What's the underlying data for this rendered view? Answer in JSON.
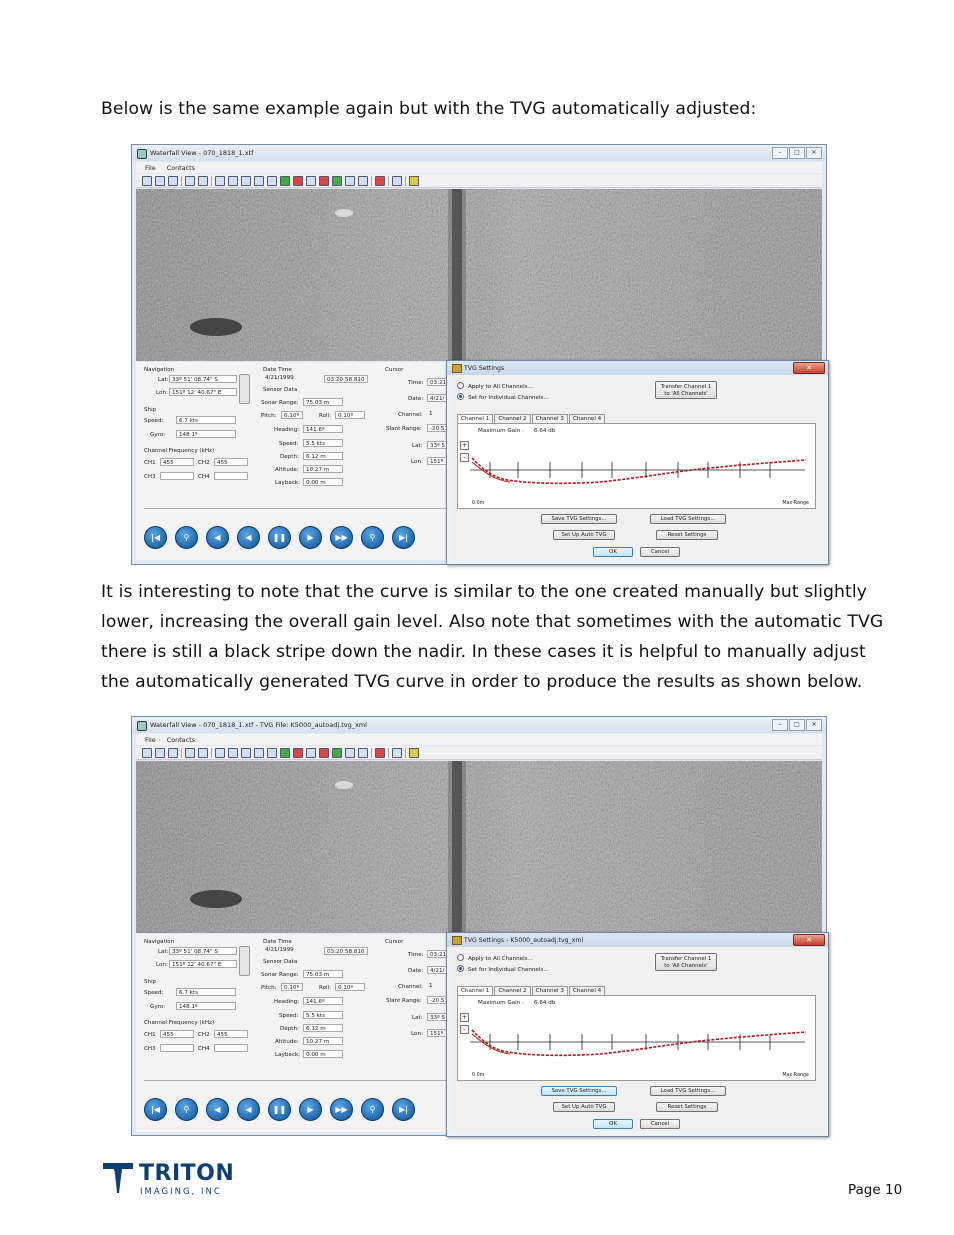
{
  "intro_text": "Below is the same example again but with the TVG automatically adjusted:",
  "body_lines": [
    "It is interesting to note that the curve is similar to the one created manually but slightly",
    "lower, increasing the overall gain level.  Also note that sometimes with the automatic TVG",
    "there is still a black stripe down the nadir.  In these cases it is helpful to manually adjust",
    "the automatically generated TVG curve in order to produce the results as shown below."
  ],
  "screenshots": [
    {
      "window_title": "Waterfall View - 070_1818_1.xtf",
      "dialog_title": "TVG Settings",
      "save_focused": false
    },
    {
      "window_title": "Waterfall View - 070_1818_1.xtf - TVG File: K5000_autoadj.tvg_xml",
      "dialog_title": "TVG Settings - K5000_autoadj.tvg_xml",
      "save_focused": true
    }
  ],
  "common": {
    "menu": [
      "File",
      "Contacts"
    ],
    "nav": {
      "navigation_label": "Navigation",
      "lat_label": "Lat:",
      "lat_value": "33º 51' 08.74\" S",
      "lon_label": "Lon:",
      "lon_value": "151º 12' 40.67\" E",
      "ship_label": "Ship",
      "speed_label": "Speed:",
      "speed_value": "6.7 kts",
      "gyro_label": "Gyro:",
      "gyro_value": "148.1º",
      "freq_label": "Channel Frequency (kHz)",
      "ch1_label": "CH1",
      "ch1_value": "455",
      "ch2_label": "CH2",
      "ch2_value": "455",
      "ch3_label": "CH3",
      "ch4_label": "CH4",
      "datetime_label": "Date Time",
      "date_value": "4/21/1999",
      "time_value": "03:20:58.810",
      "sensor_label": "Sensor Data",
      "sonar_range_label": "Sonar Range:",
      "sonar_range_value": "75.03 m",
      "pitch_label": "Pitch:",
      "pitch_value": "0.10º",
      "roll_label": "Roll:",
      "roll_value": "0.10º",
      "heading_label": "Heading:",
      "heading_value": "141.6º",
      "speed2_label": "Speed:",
      "speed2_value": "5.5 kts",
      "depth_label": "Depth:",
      "depth_value": "6.12 m",
      "altitude_label": "Altitude:",
      "altitude_value": "10.27 m",
      "layback_label": "Layback:",
      "layback_value": "0.00 m",
      "cursor_label": "Cursor",
      "c_time_label": "Time:",
      "c_time_value": "03:21",
      "c_date_label": "Date:",
      "c_date_value": "4/21/",
      "c_channel_label": "Channel:",
      "c_channel_value": "1",
      "c_slant_label": "Slant Range:",
      "c_slant_value": "-20.51",
      "c_lat_label": "Lat:",
      "c_lat_value": "33º 5",
      "c_lon_label": "Lon:",
      "c_lon_value": "151º 1"
    },
    "tvg": {
      "apply_all": "Apply to All Channels...",
      "set_individual": "Set for Individual Channels...",
      "transfer_btn_1": "Transfer Channel 1",
      "transfer_btn_2": "to 'All Channels'",
      "tabs": [
        "Channel 1",
        "Channel 2",
        "Channel 3",
        "Channel 4"
      ],
      "max_gain_label": "Maximum Gain :",
      "max_gain_value": "6.64 db",
      "x_min_label": "0.0m",
      "x_max_label": "Max Range",
      "plus": "+",
      "minus": "-",
      "save_btn": "Save TVG Settings...",
      "load_btn": "Load TVG Settings...",
      "auto_btn": "Set Up Auto TVG",
      "reset_btn": "Reset Settings",
      "ok_btn": "OK",
      "cancel_btn": "Cancel"
    },
    "play_icons": [
      "skip-back",
      "walk-back",
      "step-back",
      "rewind",
      "pause",
      "play",
      "fast-forward",
      "walk-forward",
      "skip-forward"
    ]
  },
  "footer": {
    "logo_name": "TRITON",
    "logo_sub": "IMAGING, INC",
    "page_label": "Page 10"
  },
  "colors": {
    "logo_blue": "#0f3f72",
    "tvg_curve": "#b01818",
    "play_button": "#0b4f95"
  }
}
